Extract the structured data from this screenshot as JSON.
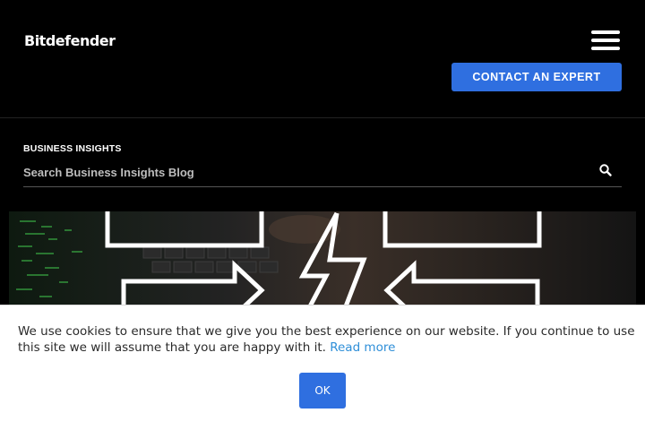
{
  "header": {
    "logo_text": "Bitdefender",
    "cta_label": "CONTACT AN EXPERT",
    "menu_icon": "hamburger-menu-icon"
  },
  "subheader": {
    "section_label": "BUSINESS INSIGHTS",
    "search_placeholder": "Search Business Insights Blog",
    "search_icon": "search-icon"
  },
  "cookie_banner": {
    "message": "We use cookies to ensure that we give you the best experience on our website. If you continue to use this site we will assume that you are happy with it.",
    "link_label": "Read more",
    "ok_label": "OK"
  },
  "colors": {
    "accent": "#2f6fe0",
    "link": "#2f8fd8",
    "background": "#000000"
  }
}
